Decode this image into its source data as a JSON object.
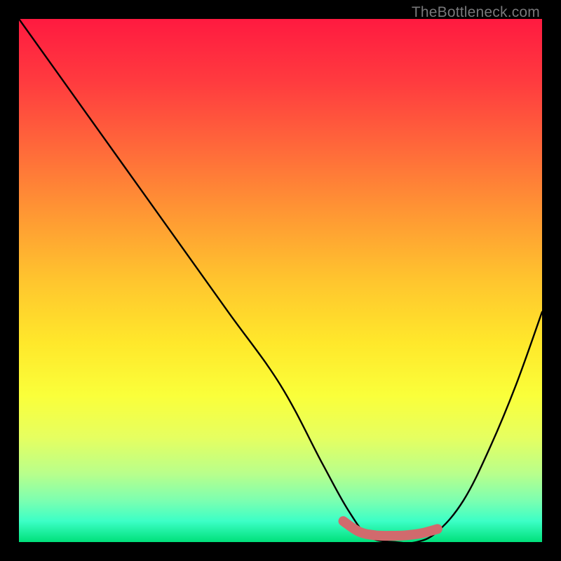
{
  "watermark": "TheBottleneck.com",
  "chart_data": {
    "type": "line",
    "title": "",
    "xlabel": "",
    "ylabel": "",
    "xlim": [
      0,
      100
    ],
    "ylim": [
      0,
      100
    ],
    "series": [
      {
        "name": "bottleneck-curve",
        "x": [
          0,
          10,
          20,
          30,
          40,
          50,
          58,
          63,
          67,
          72,
          76,
          80,
          85,
          90,
          95,
          100
        ],
        "values": [
          100,
          86,
          72,
          58,
          44,
          30,
          15,
          6,
          1,
          0,
          0,
          2,
          8,
          18,
          30,
          44
        ]
      }
    ],
    "highlight_segment": {
      "name": "optimal-range",
      "x": [
        62,
        65,
        68,
        71,
        74,
        77,
        80
      ],
      "values": [
        4,
        2,
        1.3,
        1.2,
        1.3,
        1.7,
        2.5
      ],
      "color": "#d16a6d",
      "end_dot": {
        "x": 80,
        "y": 2.5,
        "r_pct": 0.9
      }
    }
  }
}
